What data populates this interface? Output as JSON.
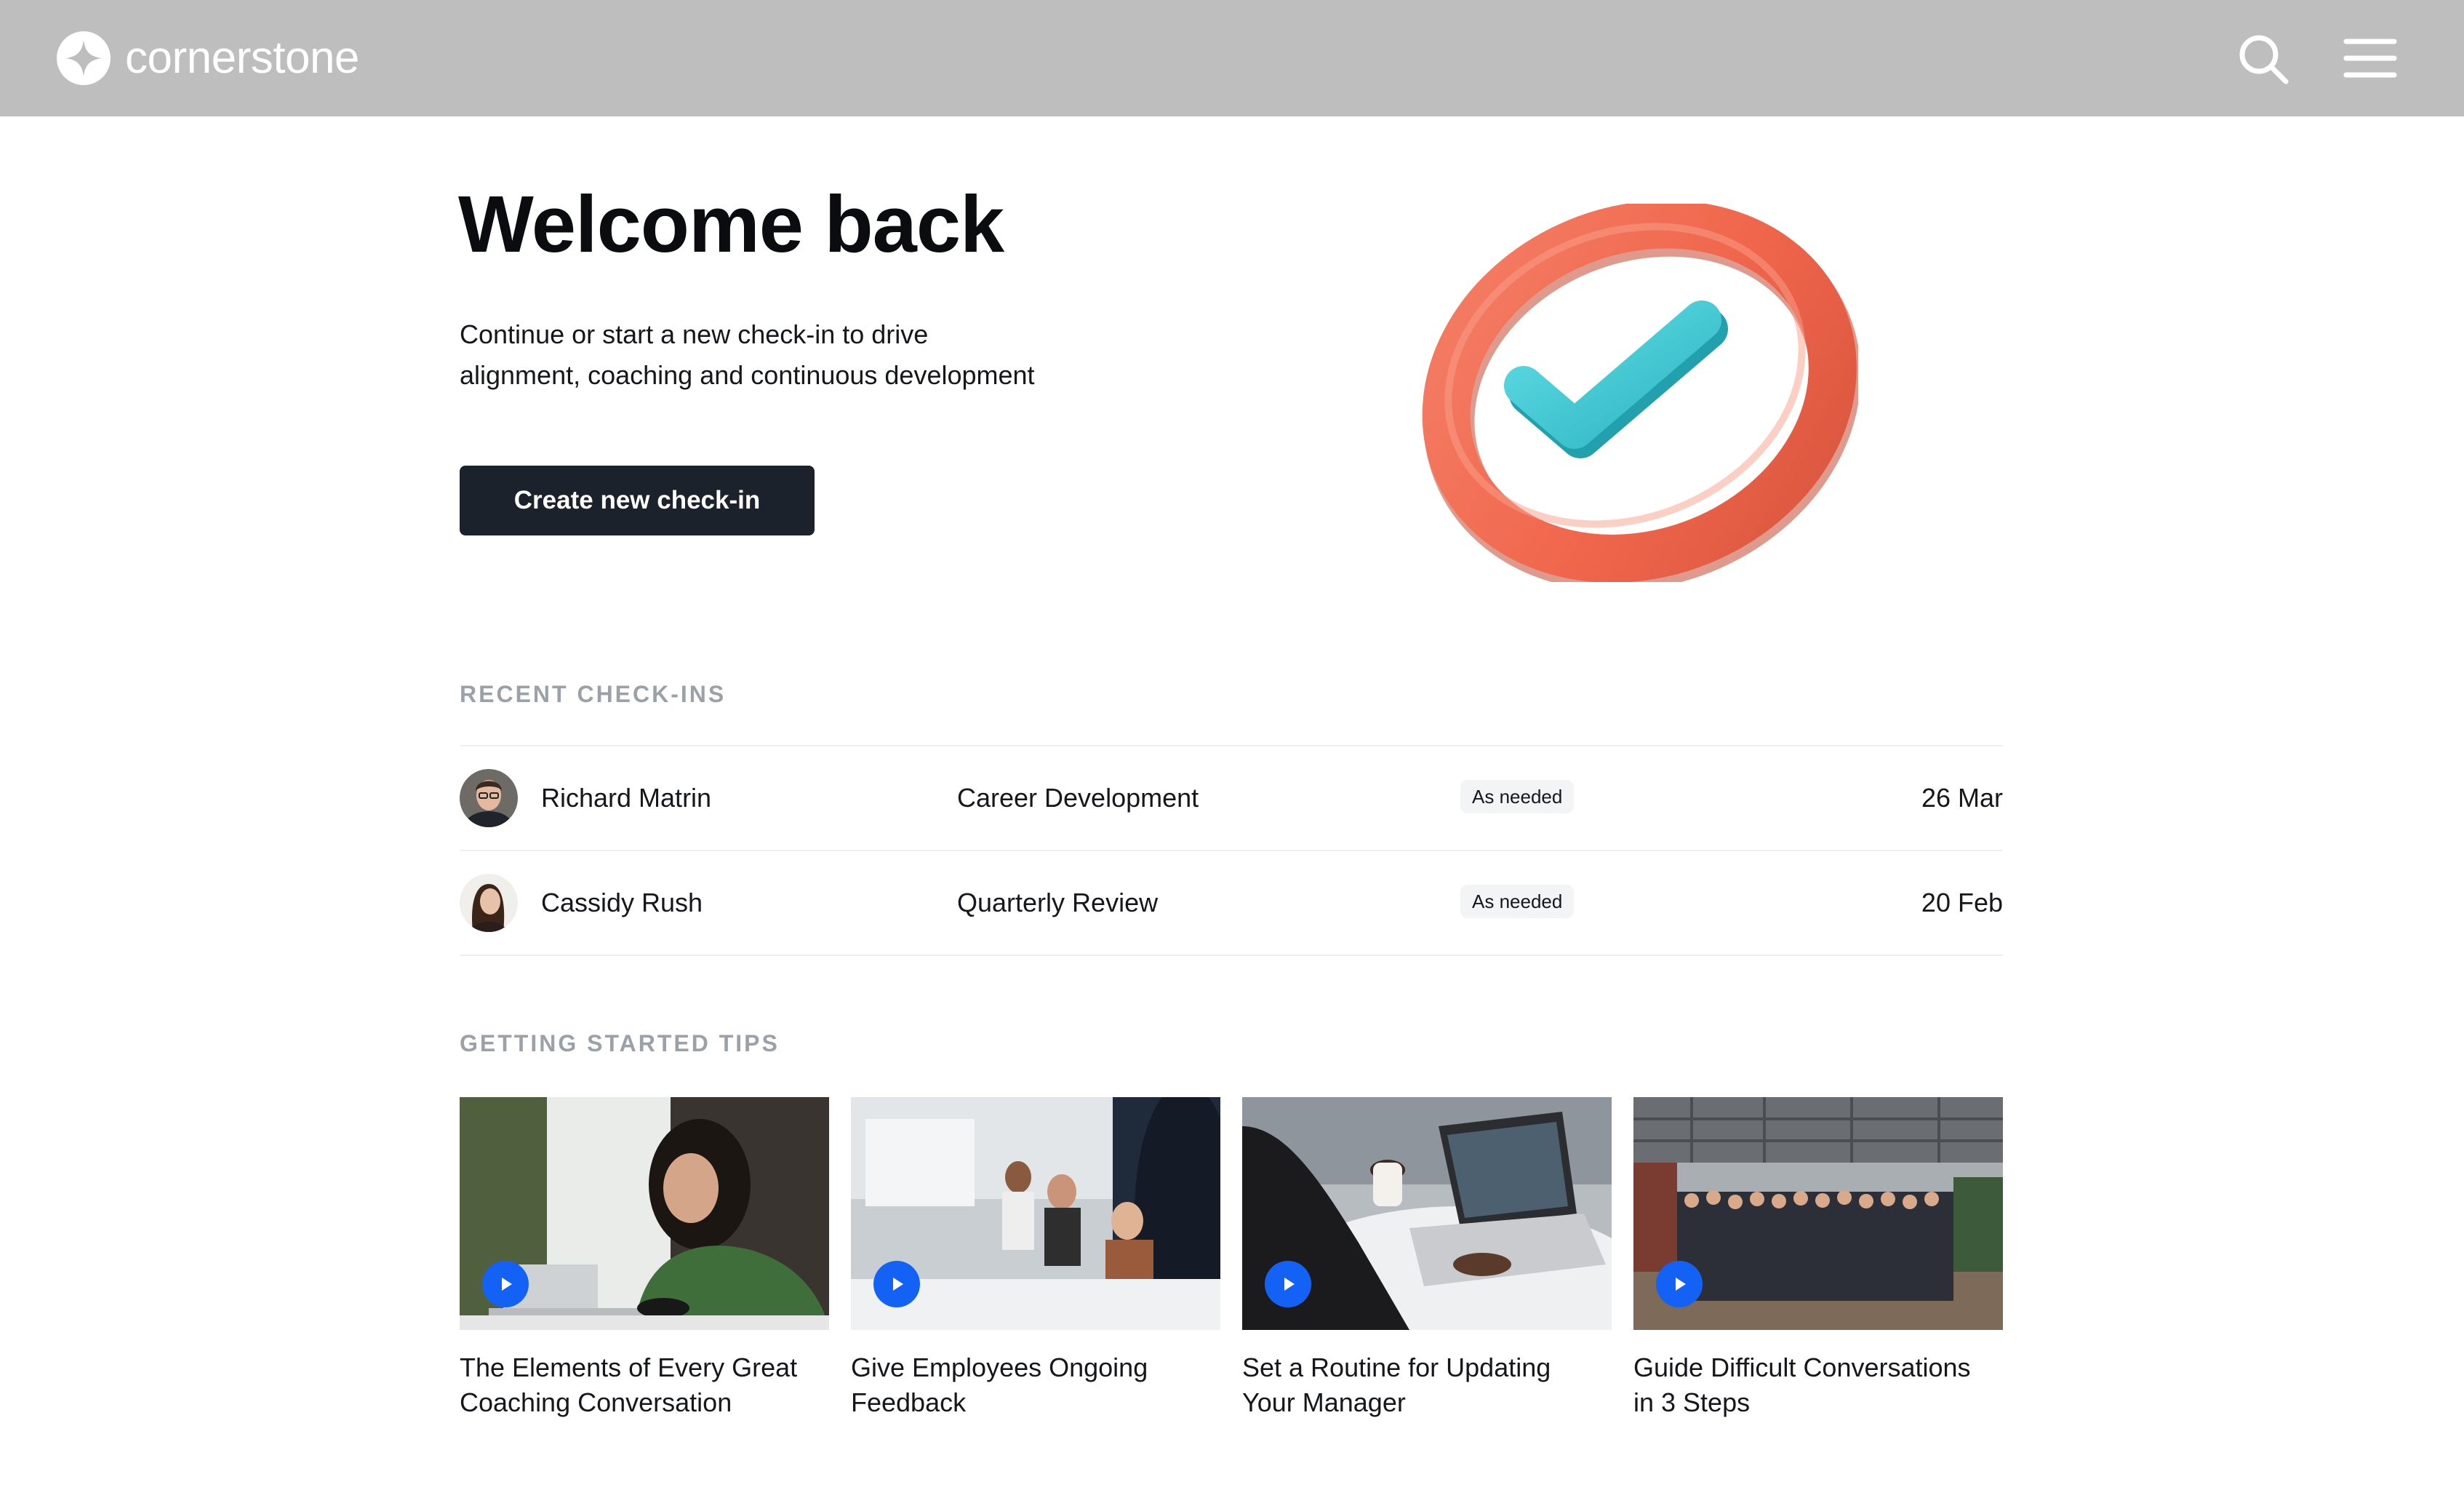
{
  "app": {
    "name": "cornerstone",
    "brand_color": "#bebebe",
    "primary_button_color": "#1c222c",
    "accent_color": "#1462f5"
  },
  "header": {
    "search_icon": "search-icon",
    "menu_icon": "hamburger-menu-icon"
  },
  "hero": {
    "title": "Welcome back",
    "subtitle_line1": "Continue or start a new check-in to drive",
    "subtitle_line2": "alignment, coaching and continuous development",
    "cta_label": "Create new check-in",
    "illustration": "checkmark-badge-illustration"
  },
  "recent_checkins": {
    "heading": "RECENT CHECK-INS",
    "rows": [
      {
        "name": "Richard Matrin",
        "type": "Career Development",
        "frequency": "As needed",
        "date": "26 Mar"
      },
      {
        "name": "Cassidy Rush",
        "type": "Quarterly Review",
        "frequency": "As needed",
        "date": "20 Feb"
      }
    ]
  },
  "tips": {
    "heading": "GETTING STARTED TIPS",
    "items": [
      {
        "title_line1": "The Elements of Every Great",
        "title_line2": "Coaching Conversation"
      },
      {
        "title_line1": "Give Employees Ongoing",
        "title_line2": "Feedback"
      },
      {
        "title_line1": "Set a Routine for Updating",
        "title_line2": "Your Manager"
      },
      {
        "title_line1": "Guide Difficult Conversations",
        "title_line2": "in 3 Steps"
      }
    ]
  }
}
